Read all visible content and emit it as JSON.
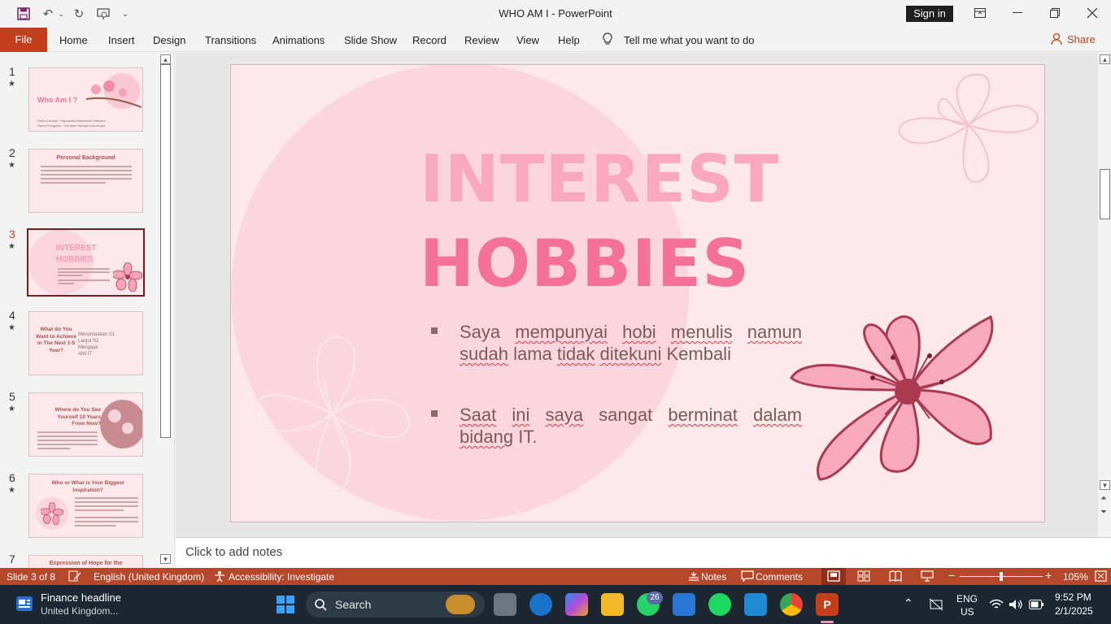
{
  "window": {
    "title": "WHO AM I  -  PowerPoint",
    "sign_in": "Sign in"
  },
  "ribbon": {
    "file": "File",
    "tabs": [
      "Home",
      "Insert",
      "Design",
      "Transitions",
      "Animations",
      "Slide Show",
      "Record",
      "Review",
      "View",
      "Help"
    ],
    "tell_me": "Tell me what you want to do",
    "share": "Share"
  },
  "thumbnails": [
    {
      "num": "1",
      "title": "Who Am I ?",
      "lines": [
        "Nama Lenkap :              Hapsahara Mahaksari Indriyani",
        "Nama Panggilan :            Indriyani Saragih Apa adaya"
      ]
    },
    {
      "num": "2",
      "title": "Personal Background",
      "lines": []
    },
    {
      "num": "3",
      "title": "INTEREST HOBBIES",
      "lines": []
    },
    {
      "num": "4",
      "title": "What do You Want to Achieve in The Next 1-5 Year?",
      "lines": [
        "Menuntaskan S1",
        "Lanjut S2",
        "Mengajar",
        "Ahli IT"
      ]
    },
    {
      "num": "5",
      "title": "Where do You See Yourself 10 Years From Now?",
      "lines": []
    },
    {
      "num": "6",
      "title": "Who or What is Your Biggest Inspiration?",
      "lines": []
    },
    {
      "num": "7",
      "title": "Expression of Hope for the",
      "lines": []
    }
  ],
  "slide": {
    "title_line1": "INTEREST",
    "title_line2": "HOBBIES",
    "bullet1": {
      "words": [
        "Saya",
        "mempunyai",
        "hobi",
        "menulis",
        "namun",
        "sudah",
        "lama",
        "tidak",
        "ditekuni",
        "Kembali"
      ]
    },
    "bullet2": {
      "words": [
        "Saat",
        "ini",
        "saya",
        "sangat",
        "berminat",
        "dalam",
        "bidang",
        "IT."
      ]
    }
  },
  "notes": {
    "placeholder": "Click to add notes"
  },
  "status": {
    "slide_count": "Slide 3 of 8",
    "language": "English (United Kingdom)",
    "accessibility": "Accessibility: Investigate",
    "notes": "Notes",
    "comments": "Comments",
    "zoom": "105%"
  },
  "taskbar": {
    "news_title": "Finance headline",
    "news_sub": "United Kingdom...",
    "search": "Search",
    "whatsapp_badge": "26",
    "lang_top": "ENG",
    "lang_bottom": "US",
    "time": "9:52 PM",
    "date": "2/1/2025"
  },
  "colors": {
    "accent": "#c43e1c",
    "status_bar": "#b7472a",
    "slide_bg": "#fde9ec",
    "title_light": "#f9a8c0",
    "title_dark": "#f5709a",
    "body_text": "#7c5a5a"
  }
}
